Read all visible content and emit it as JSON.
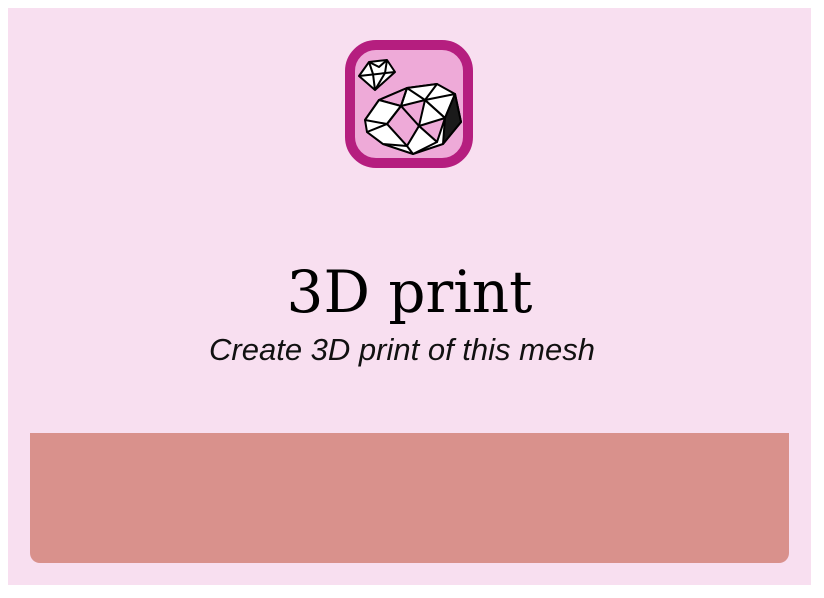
{
  "dialog": {
    "title": "3D print",
    "subtitle": "Create 3D print of this mesh"
  },
  "icon": {
    "name": "gem-mesh-icon",
    "frame_color": "#b51e7f",
    "fill_color": "#eeaad8"
  },
  "colors": {
    "background": "#f8dff0",
    "action_bar": "#d9918c"
  }
}
